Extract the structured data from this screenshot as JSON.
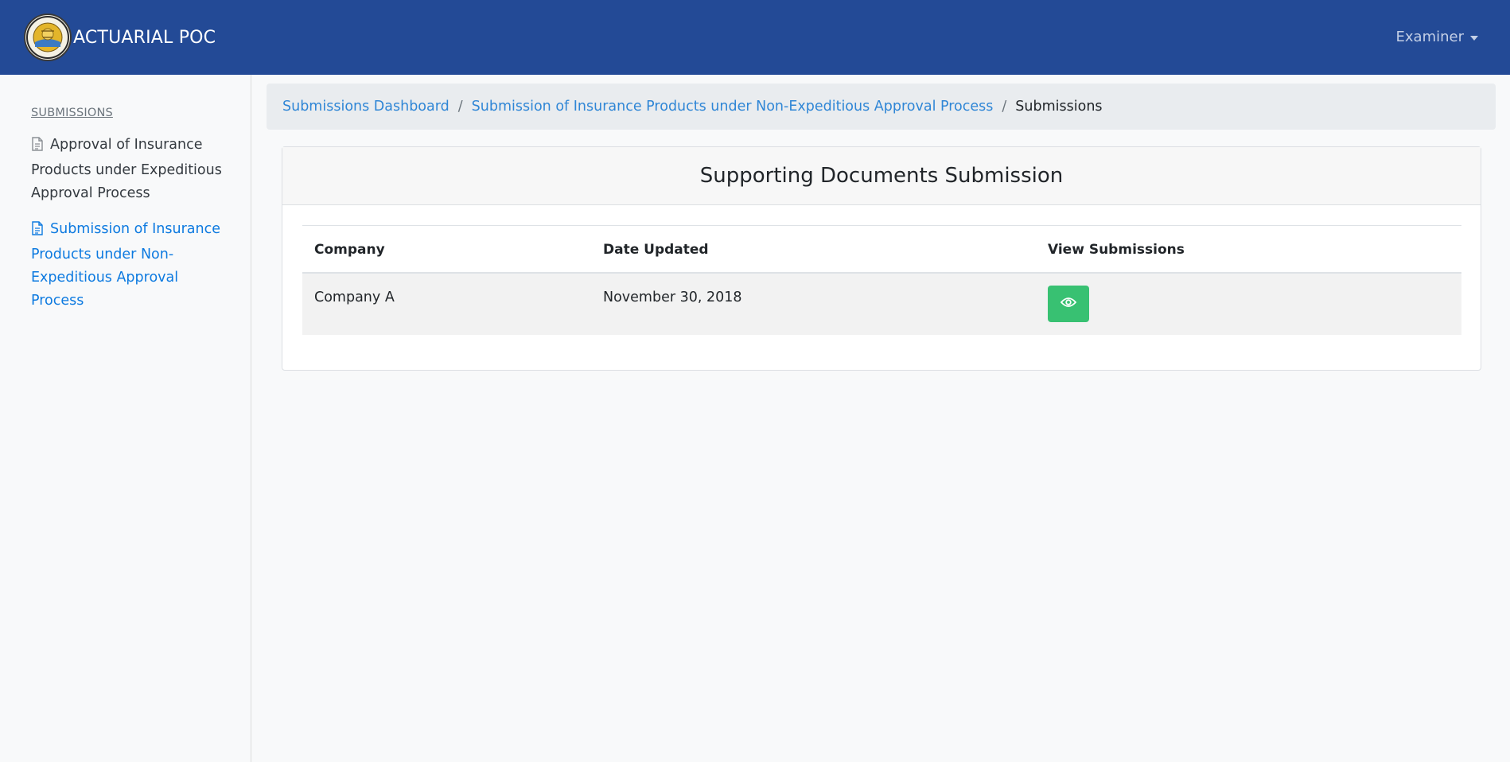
{
  "navbar": {
    "brand_title": "ACTUARIAL POC",
    "user_menu_label": "Examiner",
    "colors": {
      "background": "#234a96",
      "text": "#ffffff"
    }
  },
  "sidebar": {
    "heading": "SUBMISSIONS",
    "items": [
      {
        "label": "Approval of Insurance Products under Expeditious Approval Process",
        "icon": "document-icon",
        "active": false
      },
      {
        "label": "Submission of Insurance Products under Non-Expeditious Approval Process",
        "icon": "document-icon",
        "active": true
      }
    ]
  },
  "breadcrumb": {
    "items": [
      {
        "label": "Submissions Dashboard",
        "link": true
      },
      {
        "label": "Submission of Insurance Products under Non-Expeditious Approval Process",
        "link": true
      },
      {
        "label": "Submissions",
        "link": false
      }
    ],
    "separator": "/"
  },
  "card": {
    "title": "Supporting Documents Submission",
    "table": {
      "columns": [
        "Company",
        "Date Updated",
        "View Submissions"
      ],
      "rows": [
        {
          "company": "Company A",
          "date_updated": "November 30, 2018",
          "action_icon": "eye-icon"
        }
      ]
    }
  },
  "colors": {
    "link": "#2f86d6",
    "active_sidebar": "#0d7ae0",
    "view_button": "#38c172"
  }
}
